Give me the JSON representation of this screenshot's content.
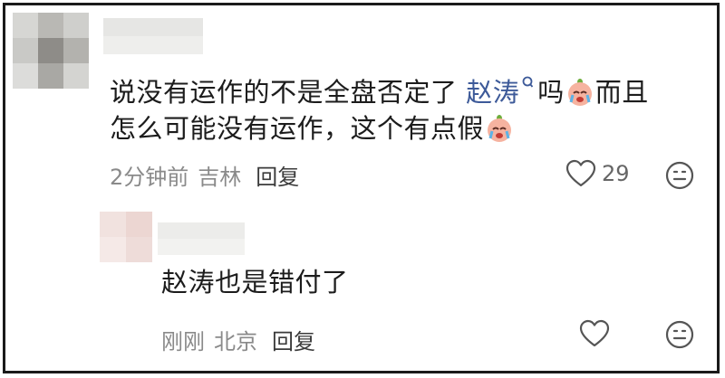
{
  "comment": {
    "text_before": "说没有运作的不是全盘否定了",
    "mention": "赵涛",
    "text_after_mention": "吗",
    "text_line1_end": "而且",
    "text_line2": "怎么可能没有运作，这个有点假",
    "time": "2分钟前",
    "location": "吉林",
    "reply_label": "回复",
    "like_count": "29"
  },
  "reply": {
    "text": "赵涛也是错付了",
    "time": "刚刚",
    "location": "北京",
    "reply_label": "回复"
  },
  "icons": {
    "like": "heart-outline-icon",
    "emoji": "smiley-face-icon",
    "mention": "search-icon",
    "inline_emoji": "crying-face-emoji"
  }
}
